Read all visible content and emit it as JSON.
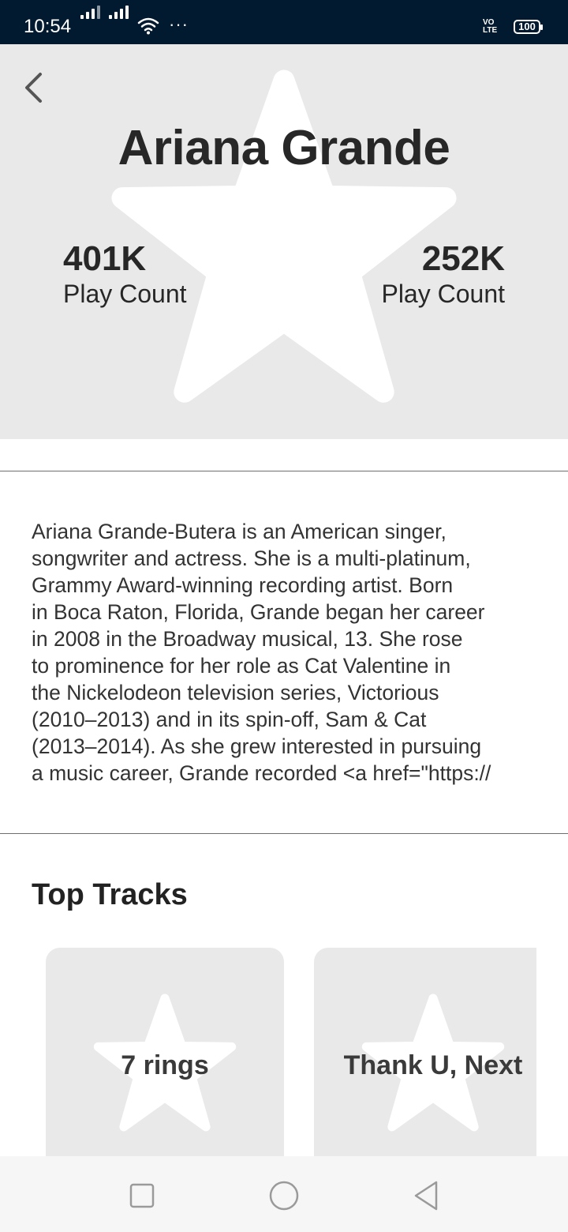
{
  "status_bar": {
    "time": "10:54",
    "dots": "···",
    "volte_line1": "VO",
    "volte_line2": "LTE",
    "battery": "100"
  },
  "header": {
    "artist_name": "Ariana Grande",
    "stats": [
      {
        "value": "401K",
        "label": "Play Count"
      },
      {
        "value": "252K",
        "label": "Play Count"
      }
    ]
  },
  "bio": {
    "lines": [
      "Ariana Grande-Butera is an American singer,",
      "songwriter and actress. She is a multi-platinum,",
      "Grammy Award-winning recording artist. Born",
      "in Boca Raton, Florida, Grande began her career",
      "in 2008 in the Broadway musical, 13. She rose",
      "to prominence for her role as Cat Valentine in",
      "the Nickelodeon television series, Victorious",
      "(2010–2013) and in its spin-off, Sam & Cat",
      "(2013–2014). As she grew interested in pursuing",
      "a music career, Grande recorded <a href=\"https://"
    ]
  },
  "top_tracks": {
    "title": "Top Tracks",
    "items": [
      {
        "title": "7 rings"
      },
      {
        "title": "Thank U, Next"
      }
    ]
  },
  "icons": {
    "back": "chevron-left-icon",
    "placeholder": "star-icon",
    "nav_recents": "square-icon",
    "nav_home": "circle-icon",
    "nav_back": "triangle-back-icon"
  },
  "colors": {
    "status_bar_bg": "#021a30",
    "header_bg": "#e9e9e9",
    "card_bg": "#e9e9e9",
    "nav_bg": "#f6f6f6"
  }
}
